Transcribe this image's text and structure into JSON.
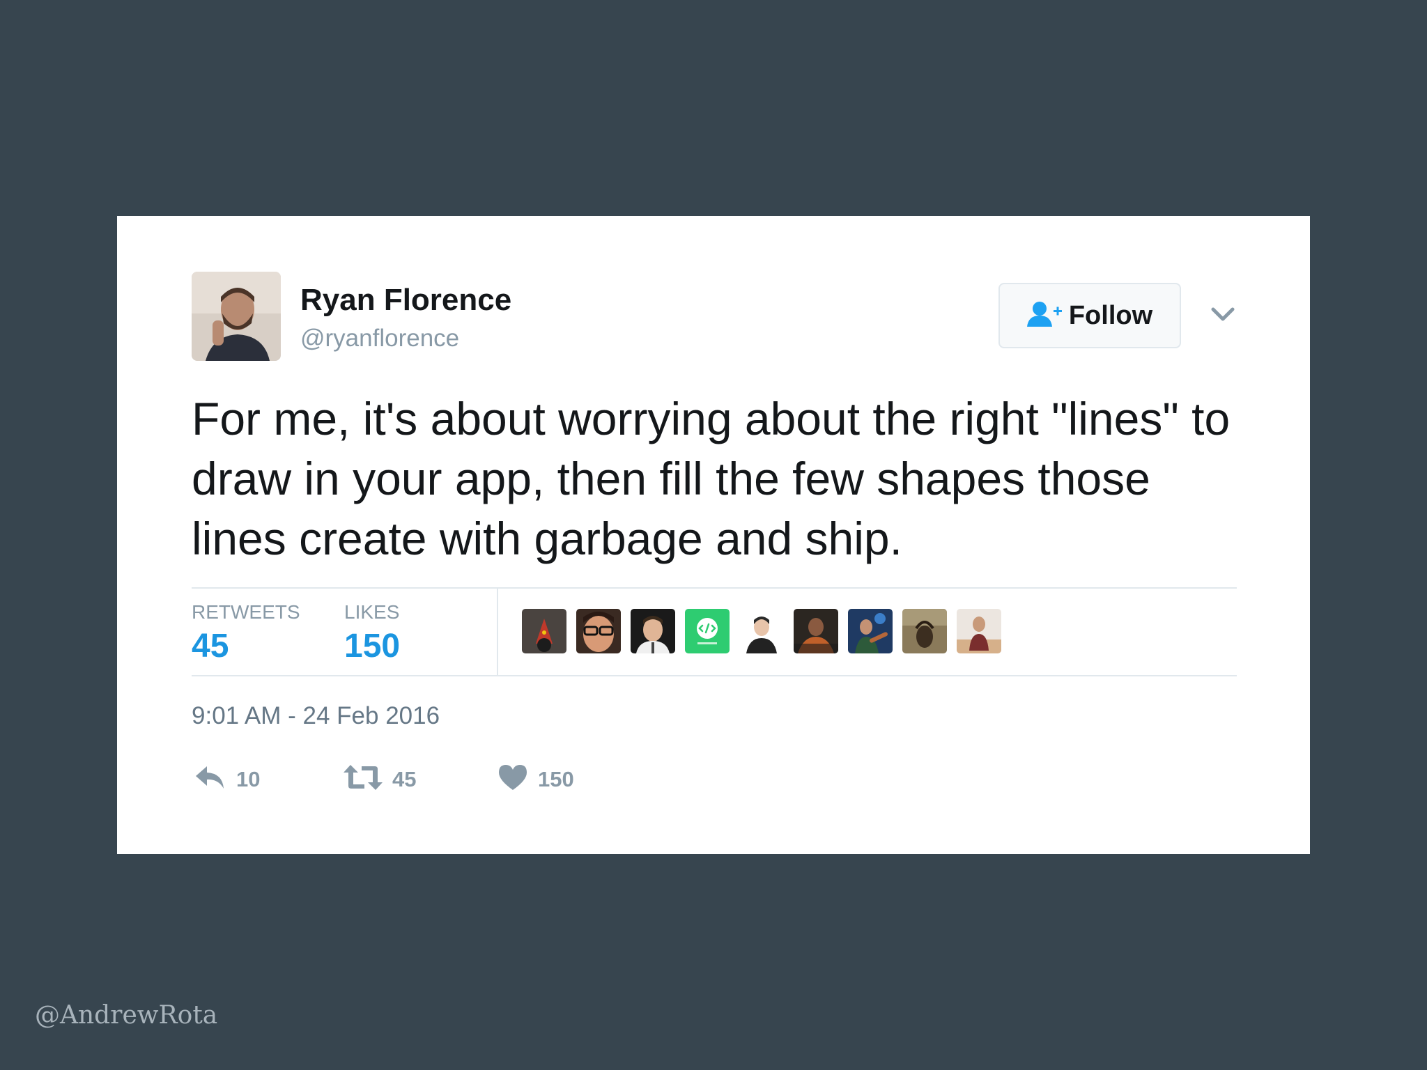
{
  "tweet": {
    "author_name": "Ryan Florence",
    "author_handle": "@ryanflorence",
    "follow_label": "Follow",
    "text": "For me, it's about worrying about the right \"lines\" to draw in your app, then fill the few shapes those lines create with garbage and ship.",
    "stats": {
      "retweets_label": "RETWEETS",
      "retweets_value": "45",
      "likes_label": "LIKES",
      "likes_value": "150"
    },
    "timestamp": "9:01 AM - 24 Feb 2016",
    "actions": {
      "replies": "10",
      "retweets": "45",
      "likes": "150"
    }
  },
  "watermark": "@AndrewRota",
  "colors": {
    "background": "#37454f",
    "accent_blue": "#1b95e0",
    "muted": "#8899a6",
    "text": "#14171a"
  },
  "icons": [
    "follow-person-icon",
    "chevron-down-icon",
    "reply-icon",
    "retweet-icon",
    "heart-icon"
  ]
}
